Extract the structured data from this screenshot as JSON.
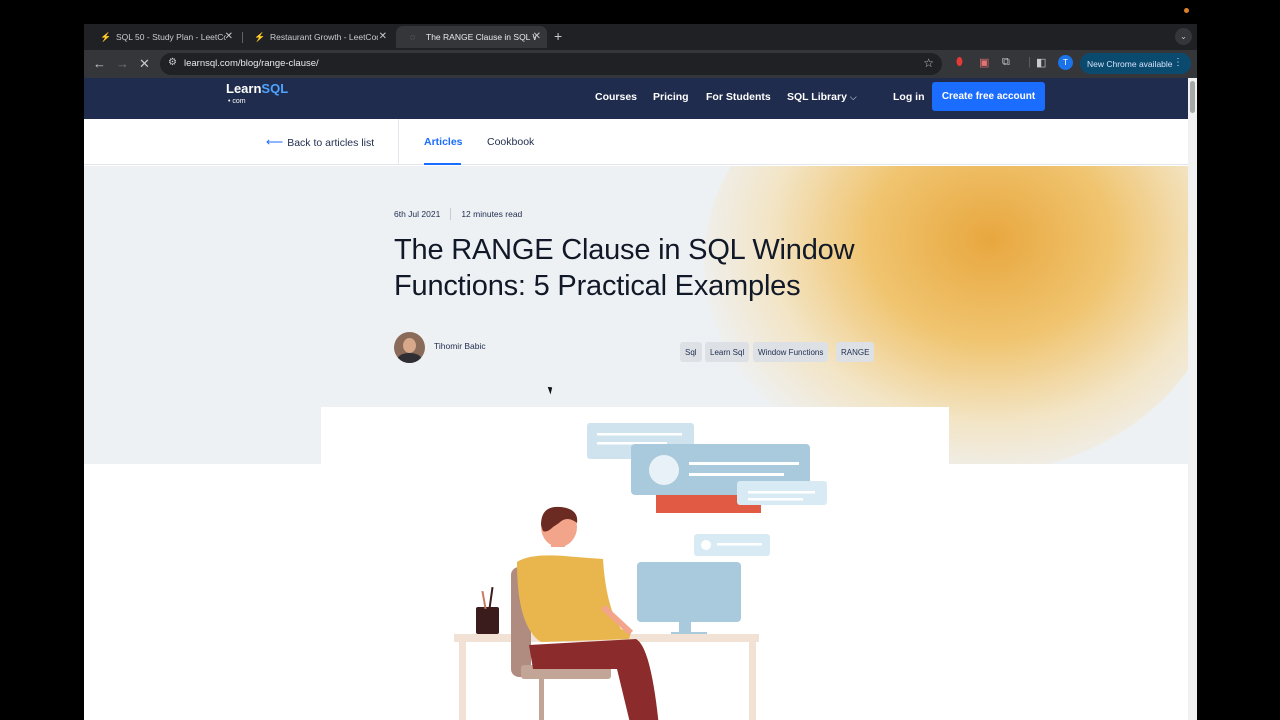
{
  "browser": {
    "tabs": [
      {
        "title": "SQL 50 - Study Plan - LeetCode",
        "active": false
      },
      {
        "title": "Restaurant Growth - LeetCode",
        "active": false
      },
      {
        "title": "The RANGE Clause in SQL Window",
        "active": true
      }
    ],
    "url": "learnsql.com/blog/range-clause/",
    "profile_initial": "T",
    "new_chrome_label": "New Chrome available"
  },
  "site": {
    "logo_main": "Learn",
    "logo_sql": "SQL",
    "logo_com": "• com",
    "nav": [
      "Courses",
      "Pricing",
      "For Students",
      "SQL Library"
    ],
    "login": "Log in",
    "cta": "Create free account"
  },
  "subnav": {
    "back": "Back to articles list",
    "tabs": [
      "Articles",
      "Cookbook"
    ]
  },
  "article": {
    "date": "6th Jul 2021",
    "read_time": "12 minutes read",
    "title": "The RANGE Clause in SQL Window Functions: 5 Practical Examples",
    "author": "Tihomir Babic",
    "tags": [
      "Sql",
      "Learn Sql",
      "Window Functions",
      "RANGE"
    ]
  }
}
